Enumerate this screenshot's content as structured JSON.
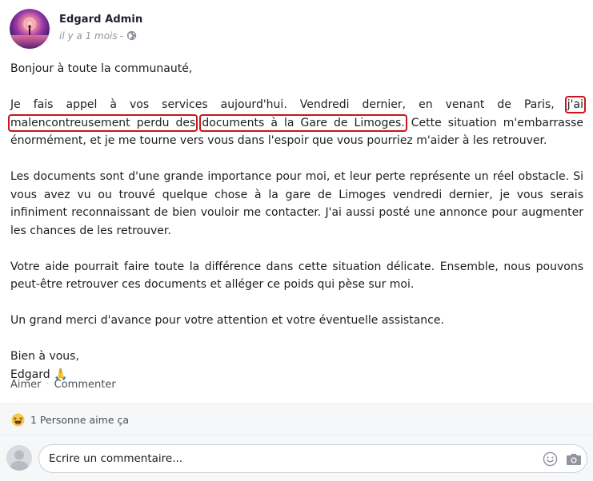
{
  "post": {
    "author": "Edgard Admin",
    "time": "il y a 1 mois",
    "separator": "-",
    "icons": {
      "avatar": "avatar-image",
      "privacy": "globe-icon"
    },
    "body": {
      "greeting": "Bonjour à toute la communauté,",
      "p1_before": "Je fais appel à vos services aujourd'hui. Vendredi dernier, en venant de Paris,",
      "p1_highlight_1": "j'ai malencontreusement perdu des",
      "p1_highlight_2": "documents à la Gare de Limoges.",
      "p1_after": "Cette situation m'embarrasse énormément, et je me tourne vers vous dans l'espoir que vous pourriez m'aider à les retrouver.",
      "p2": "Les documents sont d'une grande importance pour moi, et leur perte représente un réel obstacle. Si vous avez vu ou trouvé quelque chose à la gare de Limoges vendredi dernier, je vous serais infiniment reconnaissant de bien vouloir me contacter. J'ai aussi posté une annonce pour augmenter les chances de les retrouver.",
      "p3": "Votre aide pourrait faire toute la différence dans cette situation délicate. Ensemble, nous pouvons peut-être retrouver ces documents et alléger ce poids qui pèse sur moi.",
      "p4": "Un grand merci d'avance pour votre attention et votre éventuelle assistance.",
      "closing": "Bien à vous,",
      "signature": "Edgard",
      "signature_emoji": "🙏"
    },
    "highlight_color": "#c8161d",
    "actions": {
      "like": "Aimer",
      "dot": "·",
      "comment": "Commenter"
    },
    "likes": {
      "text": "1 Personne aime ça",
      "icon": "haha-emoji-icon"
    },
    "comment_box": {
      "placeholder": "Ecrire un commentaire...",
      "emoji_icon": "smiley-icon",
      "camera_icon": "camera-icon"
    }
  }
}
